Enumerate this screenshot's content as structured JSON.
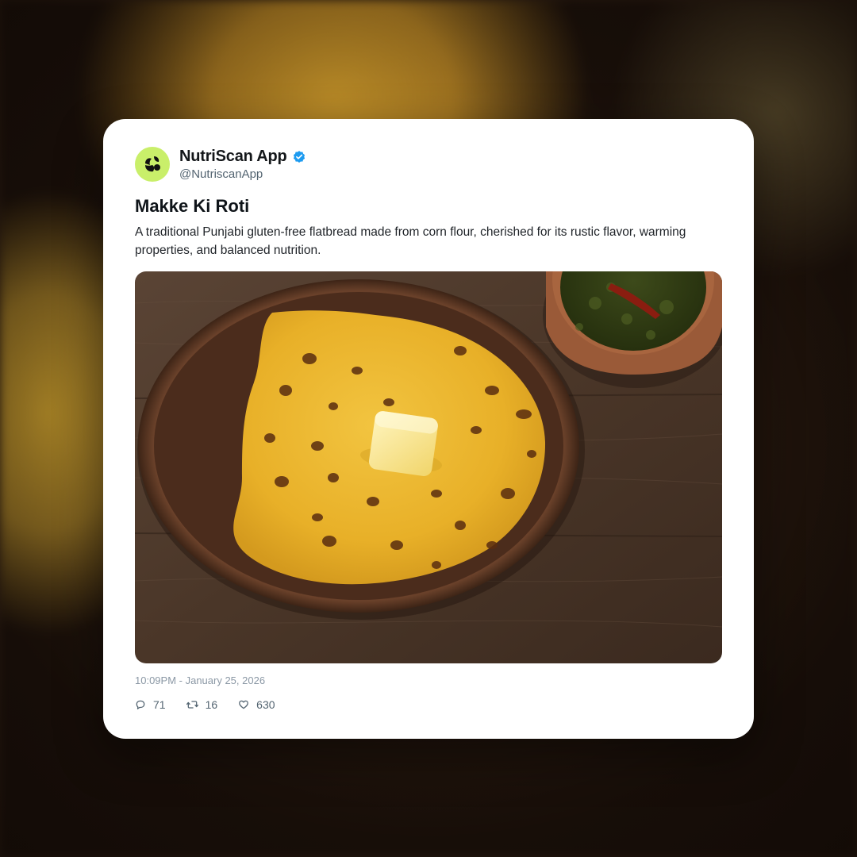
{
  "post": {
    "display_name": "NutriScan App",
    "handle": "@NutriscanApp",
    "verified": true,
    "title": "Makke Ki Roti",
    "description": "A traditional Punjabi gluten-free flatbread made from corn flour, cherished for its rustic flavor, warming properties, and balanced nutrition.",
    "timestamp": "10:09PM - January 25, 2026",
    "stats": {
      "replies": "71",
      "retweets": "16",
      "likes": "630"
    }
  },
  "colors": {
    "avatar_bg": "#c9ef6a",
    "verified_blue": "#1d9bf0"
  },
  "icons": {
    "avatar": "leaf-logo-icon",
    "verified": "verified-badge-icon",
    "reply": "comment-icon",
    "retweet": "retweet-icon",
    "like": "heart-icon"
  }
}
